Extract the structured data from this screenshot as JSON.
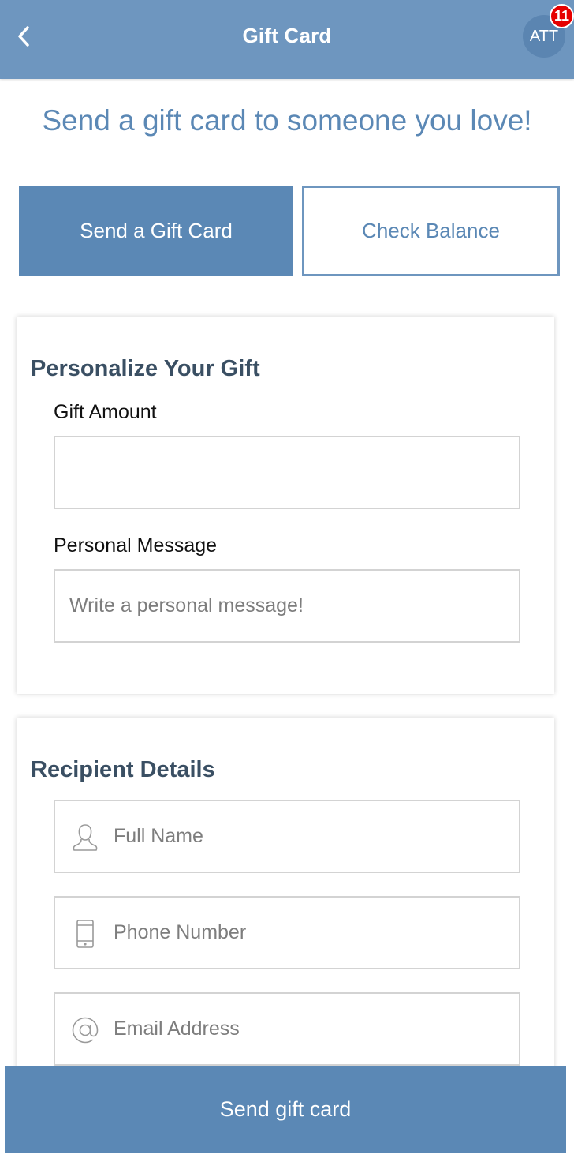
{
  "header": {
    "title": "Gift Card",
    "avatar_initials": "ATT",
    "notification_count": "11",
    "back_icon": "chevron-left-icon"
  },
  "page": {
    "heading": "Send a gift card to someone you love!"
  },
  "tabs": [
    {
      "label": "Send a Gift Card",
      "active": true
    },
    {
      "label": "Check Balance",
      "active": false
    }
  ],
  "personalize": {
    "title": "Personalize Your Gift",
    "gift_amount_label": "Gift Amount",
    "gift_amount_value": "",
    "gift_amount_placeholder": "",
    "personal_message_label": "Personal Message",
    "personal_message_placeholder": "Write a personal message!"
  },
  "recipient": {
    "title": "Recipient Details",
    "full_name_placeholder": "Full Name",
    "full_name_icon": "person-icon",
    "phone_placeholder": "Phone Number",
    "phone_icon": "phone-icon",
    "email_placeholder": "Email Address",
    "email_icon": "at-sign-icon"
  },
  "actions": {
    "send_label": "Send gift card"
  },
  "colors": {
    "header_bg": "#6e96bf",
    "accent": "#5b88b5",
    "badge": "#e60000",
    "card_title": "#3a4f63"
  }
}
